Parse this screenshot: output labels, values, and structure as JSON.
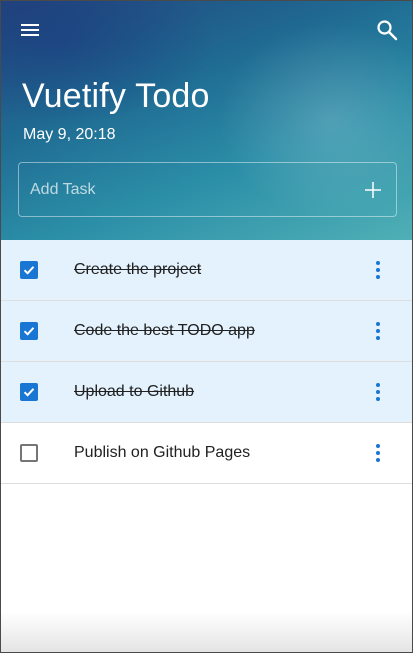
{
  "app": {
    "title": "Vuetify Todo",
    "date": "May 9, 20:18"
  },
  "header": {
    "menu_icon": "menu-icon",
    "search_icon": "search-icon"
  },
  "add_task": {
    "placeholder": "Add Task",
    "value": "",
    "add_icon": "plus-icon"
  },
  "colors": {
    "accent": "#1976d2",
    "done_row": "#e3f2fd"
  },
  "tasks": [
    {
      "label": "Create the project",
      "done": true
    },
    {
      "label": "Code the best TODO app",
      "done": true
    },
    {
      "label": "Upload to Github",
      "done": true
    },
    {
      "label": "Publish on Github Pages",
      "done": false
    }
  ]
}
